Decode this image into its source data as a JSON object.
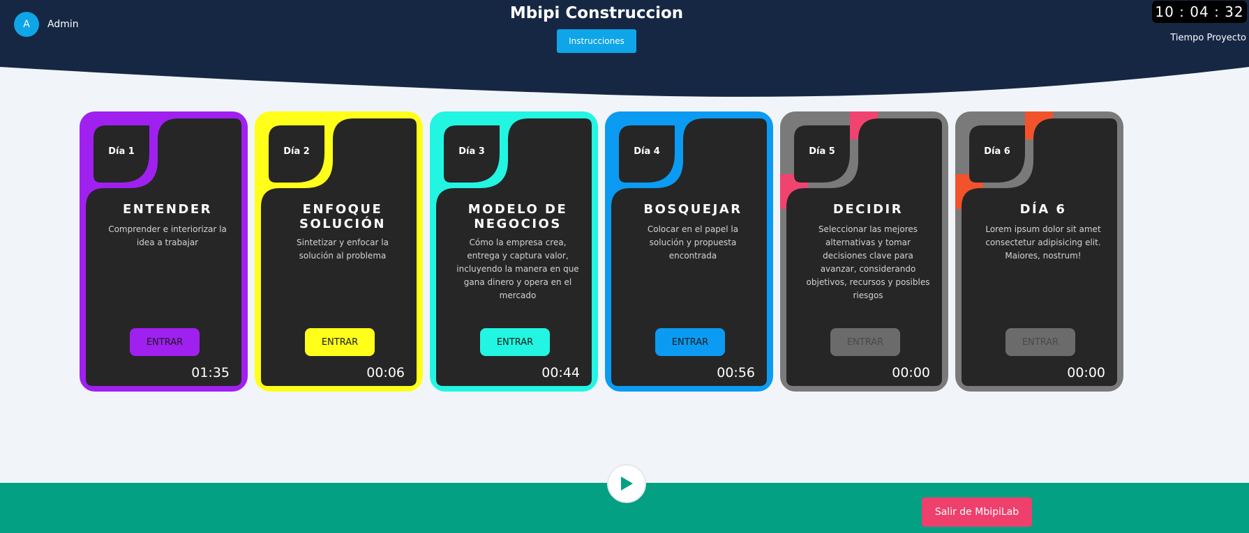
{
  "header": {
    "avatar_initial": "A",
    "user_name": "Admin",
    "title": "Mbipi Construccion",
    "instructions_label": "Instrucciones",
    "clock": "10 : 04 : 32",
    "clock_label": "Tiempo Proyecto"
  },
  "cards": [
    {
      "day": "Día 1",
      "title": "ENTENDER",
      "description": "Comprender e interiorizar la idea a trabajar",
      "button": "ENTRAR",
      "timer": "01:35",
      "color": "#a020f0",
      "button_text_color": "#1a1a1a",
      "status": "active"
    },
    {
      "day": "Día 2",
      "title": "ENFOQUE\nSOLUCIÓN",
      "description": "Sintetizar y enfocar la solución al problema",
      "button": "ENTRAR",
      "timer": "00:06",
      "color": "#ffff1a",
      "button_text_color": "#1a1a1a",
      "status": "active"
    },
    {
      "day": "Día 3",
      "title": "MODELO DE\nNEGOCIOS",
      "description": "Cómo la empresa crea, entrega y captura valor, incluyendo la manera en que gana dinero y opera en el mercado",
      "button": "ENTRAR",
      "timer": "00:44",
      "color": "#22f5e1",
      "button_text_color": "#1a1a1a",
      "status": "active"
    },
    {
      "day": "Día 4",
      "title": "BOSQUEJAR",
      "description": "Colocar en el papel la solución y propuesta encontrada",
      "button": "ENTRAR",
      "timer": "00:56",
      "color": "#0b9bf2",
      "button_text_color": "#1a1a1a",
      "status": "active"
    },
    {
      "day": "Día 5",
      "title": "DECIDIR",
      "description": "Seleccionar las mejores alternativas y tomar decisiones clave para avanzar, considerando objetivos, recursos y posibles riesgos",
      "button": "ENTRAR",
      "timer": "00:00",
      "color": "#7a7a7a",
      "accent": "#f0436f",
      "button_text_color": "#4a4a4a",
      "status": "locked"
    },
    {
      "day": "Día 6",
      "title": "DÍA 6",
      "description": "Lorem ipsum dolor sit amet consectetur adipisicing elit. Maiores, nostrum!",
      "button": "ENTRAR",
      "timer": "00:00",
      "color": "#7a7a7a",
      "accent": "#f2532c",
      "button_text_color": "#4a4a4a",
      "status": "locked"
    }
  ],
  "footer": {
    "exit_label": "Salir de MbipiLab"
  },
  "colors": {
    "header_bg": "#162744",
    "card_inner": "#262626",
    "footer_bg": "#04a083",
    "exit_button": "#ef3f6c",
    "instructions_button": "#0ea5e9"
  }
}
